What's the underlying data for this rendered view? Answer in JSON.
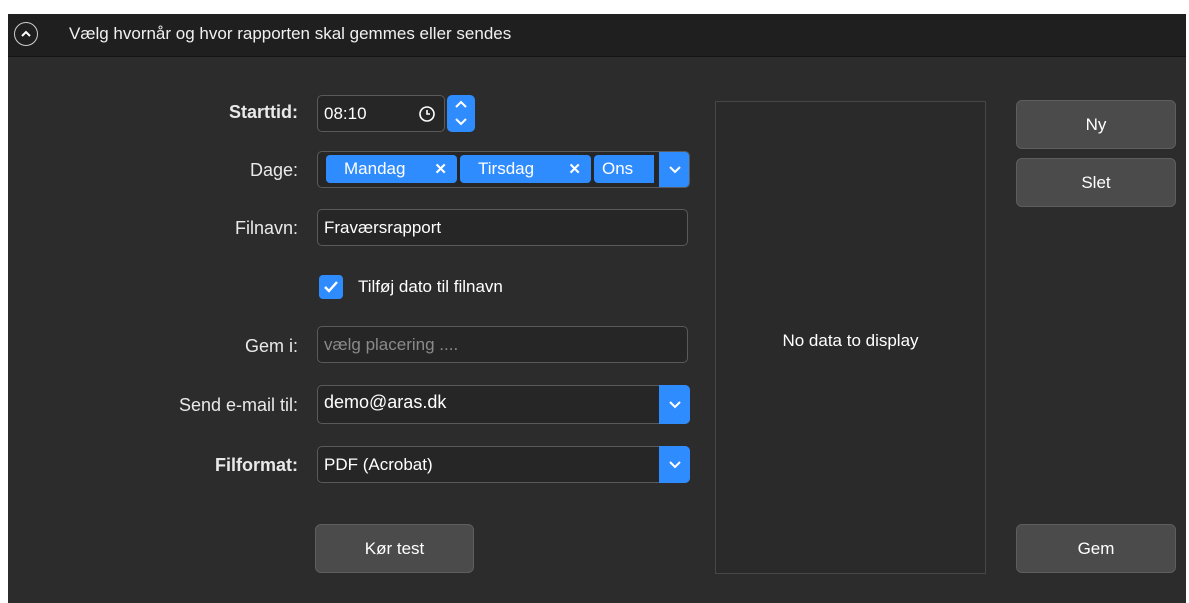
{
  "header": {
    "title": "Vælg hvornår og hvor rapporten skal gemmes eller sendes",
    "collapse_icon": "chevron-up-icon"
  },
  "form": {
    "start_time": {
      "label": "Starttid:",
      "value": "08:10"
    },
    "days": {
      "label": "Dage:",
      "tags": [
        "Mandag",
        "Tirsdag",
        "Ons"
      ]
    },
    "filename": {
      "label": "Filnavn:",
      "value": "Fraværsrapport"
    },
    "add_date": {
      "label": "Tilføj dato til filnavn",
      "checked": true
    },
    "save_in": {
      "label": "Gem i:",
      "placeholder": "vælg placering ...."
    },
    "send_email": {
      "label": "Send e-mail til:",
      "value": "demo@aras.dk"
    },
    "file_format": {
      "label": "Filformat:",
      "value": "PDF (Acrobat)"
    },
    "run_test_label": "Kør test"
  },
  "preview": {
    "message": "No data to display"
  },
  "actions": {
    "new_label": "Ny",
    "delete_label": "Slet",
    "save_label": "Gem"
  },
  "colors": {
    "accent": "#2f8cff",
    "panel": "#2c2c2c",
    "header": "#1f1f1f"
  }
}
